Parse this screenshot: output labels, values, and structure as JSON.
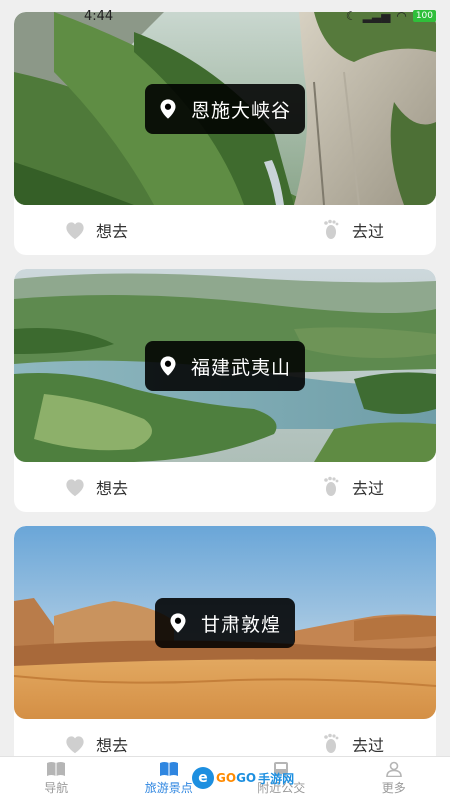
{
  "status_bar": {
    "time": "4:44",
    "battery": "100"
  },
  "places": [
    {
      "name": "恩施大峡谷",
      "want_label": "想去",
      "been_label": "去过"
    },
    {
      "name": "福建武夷山",
      "want_label": "想去",
      "been_label": "去过"
    },
    {
      "name": "甘肃敦煌",
      "want_label": "想去",
      "been_label": "去过"
    }
  ],
  "tabs": [
    {
      "label": "导航",
      "icon": "book-icon",
      "active": false
    },
    {
      "label": "旅游景点",
      "icon": "open-book-icon",
      "active": true
    },
    {
      "label": "附近公交",
      "icon": "bus-icon",
      "active": false
    },
    {
      "label": "更多",
      "icon": "person-icon",
      "active": false
    }
  ],
  "watermark": {
    "brand_a": "GO",
    "brand_b": "GO",
    "site": "手游网"
  },
  "colors": {
    "accent": "#2f86e0",
    "inactive": "#9a9a9a"
  }
}
